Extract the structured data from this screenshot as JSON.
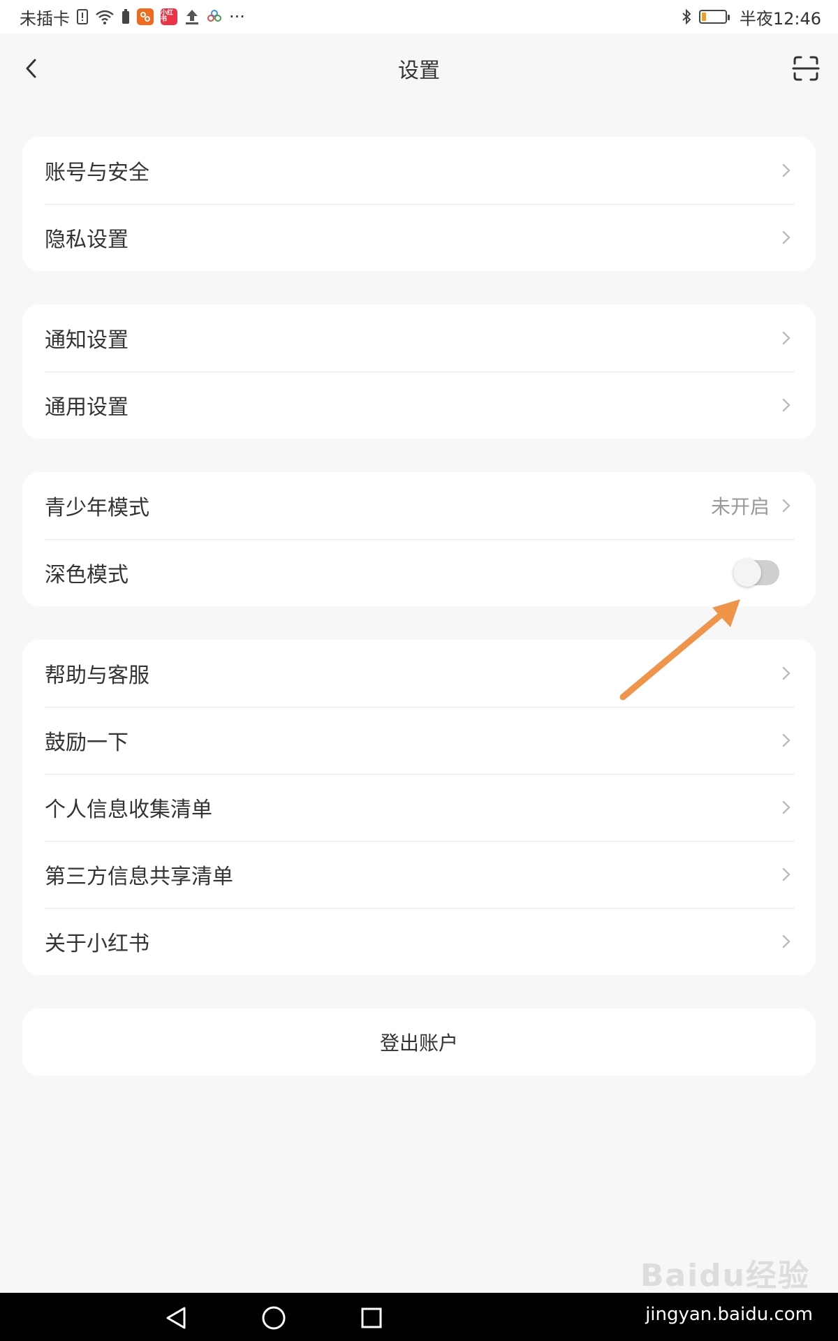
{
  "status_bar": {
    "carrier": "未插卡",
    "app_badge_text": "小红书",
    "time": "半夜12:46",
    "battery_level": 0.2,
    "more": "···"
  },
  "nav": {
    "title": "设置"
  },
  "groups": [
    {
      "items": [
        {
          "label": "账号与安全"
        },
        {
          "label": "隐私设置"
        }
      ]
    },
    {
      "items": [
        {
          "label": "通知设置"
        },
        {
          "label": "通用设置"
        }
      ]
    },
    {
      "items": [
        {
          "label": "青少年模式",
          "value": "未开启"
        },
        {
          "label": "深色模式",
          "toggle": false
        }
      ]
    },
    {
      "items": [
        {
          "label": "帮助与客服"
        },
        {
          "label": "鼓励一下"
        },
        {
          "label": "个人信息收集清单"
        },
        {
          "label": "第三方信息共享清单"
        },
        {
          "label": "关于小红书"
        }
      ]
    }
  ],
  "logout_label": "登出账户",
  "watermark": {
    "logo": "Baidu经验",
    "url": "jingyan.baidu.com"
  },
  "colors": {
    "background": "#f7f7f7",
    "card": "#ffffff",
    "annotation_arrow": "#f0944a",
    "toggle_off": "#cfcfcf"
  }
}
